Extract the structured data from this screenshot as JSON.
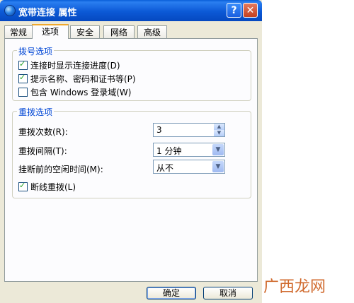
{
  "window": {
    "title": "宽带连接 属性",
    "help_label": "?",
    "close_label": "✕"
  },
  "tabs": [
    {
      "label": "常规"
    },
    {
      "label": "选项"
    },
    {
      "label": "安全"
    },
    {
      "label": "网络"
    },
    {
      "label": "高级"
    }
  ],
  "active_tab": "选项",
  "dial_options": {
    "title": "拨号选项",
    "items": [
      {
        "label": "连接时显示连接进度(D)",
        "checked": true
      },
      {
        "label": "提示名称、密码和证书等(P)",
        "checked": true
      },
      {
        "label": "包含 Windows 登录域(W)",
        "checked": false
      }
    ]
  },
  "redial_options": {
    "title": "重拨选项",
    "redial_attempts": {
      "label": "重拨次数(R):",
      "value": "3"
    },
    "redial_interval": {
      "label": "重拨间隔(T):",
      "value": "1 分钟"
    },
    "idle_time": {
      "label": "挂断前的空闲时间(M):",
      "value": "从不"
    },
    "redial_if_dropped": {
      "label": "断线重拨(L)",
      "checked": true
    }
  },
  "buttons": {
    "ok": "确定",
    "cancel": "取消"
  },
  "watermark": "广西龙网"
}
